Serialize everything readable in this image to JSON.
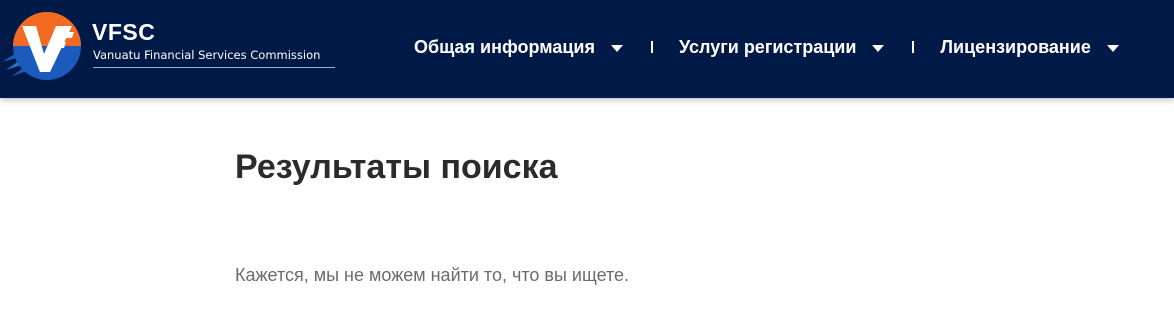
{
  "header": {
    "logo": {
      "title": "VFSC",
      "subtitle": "Vanuatu Financial Services Commission",
      "icon": "vfsc-logo-icon",
      "colors": {
        "orange": "#f26a21",
        "blue": "#1b5bbd",
        "navy": "#001a47"
      }
    },
    "nav": {
      "items": [
        {
          "label": "Общая информация",
          "icon": "chevron-down-icon"
        },
        {
          "label": "Услуги регистрации",
          "icon": "chevron-down-icon"
        },
        {
          "label": "Лицензирование",
          "icon": "chevron-down-icon"
        }
      ]
    },
    "background": "#001a47"
  },
  "main": {
    "title": "Результаты поиска",
    "message": "Кажется, мы не можем найти то, что вы ищете."
  }
}
